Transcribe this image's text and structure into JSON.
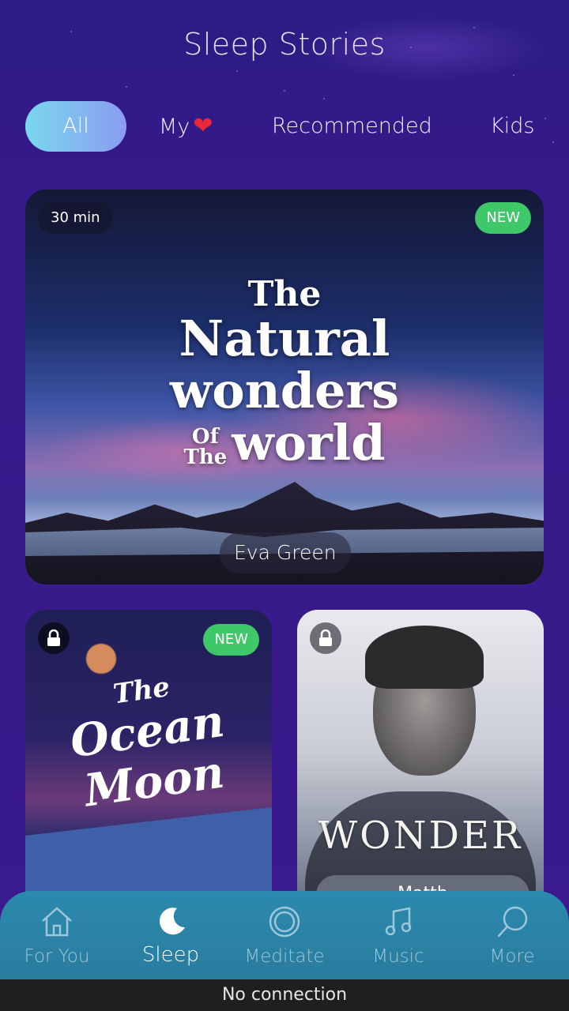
{
  "header": {
    "title": "Sleep Stories"
  },
  "tabs": [
    {
      "label": "All",
      "active": true
    },
    {
      "label": "My",
      "icon": "heart-icon"
    },
    {
      "label": "Recommended"
    },
    {
      "label": "Kids"
    }
  ],
  "featured": {
    "duration": "30 min",
    "badge": "NEW",
    "title_lines": [
      "The",
      "Natural",
      "wonders",
      "Of",
      "The",
      "world"
    ],
    "narrator": "Eva Green"
  },
  "cards": [
    {
      "locked": true,
      "badge": "NEW",
      "title_lines": [
        "The",
        "Ocean",
        "Moon"
      ]
    },
    {
      "locked": true,
      "title": "WONDER",
      "narrator": "Matth"
    }
  ],
  "bottom_nav": [
    {
      "label": "For You",
      "icon": "home-icon"
    },
    {
      "label": "Sleep",
      "icon": "moon-icon",
      "active": true
    },
    {
      "label": "Meditate",
      "icon": "circle-icon"
    },
    {
      "label": "Music",
      "icon": "music-note-icon"
    },
    {
      "label": "More",
      "icon": "search-icon"
    }
  ],
  "status": {
    "message": "No connection"
  },
  "colors": {
    "background": "#361a8a",
    "tab_active_start": "#7ad8ee",
    "tab_active_end": "#8a9cf0",
    "new_badge": "#3ec86a",
    "heart": "#e8283b",
    "nav_background": "#2b8aae",
    "status_bar": "#1f1f1f"
  }
}
